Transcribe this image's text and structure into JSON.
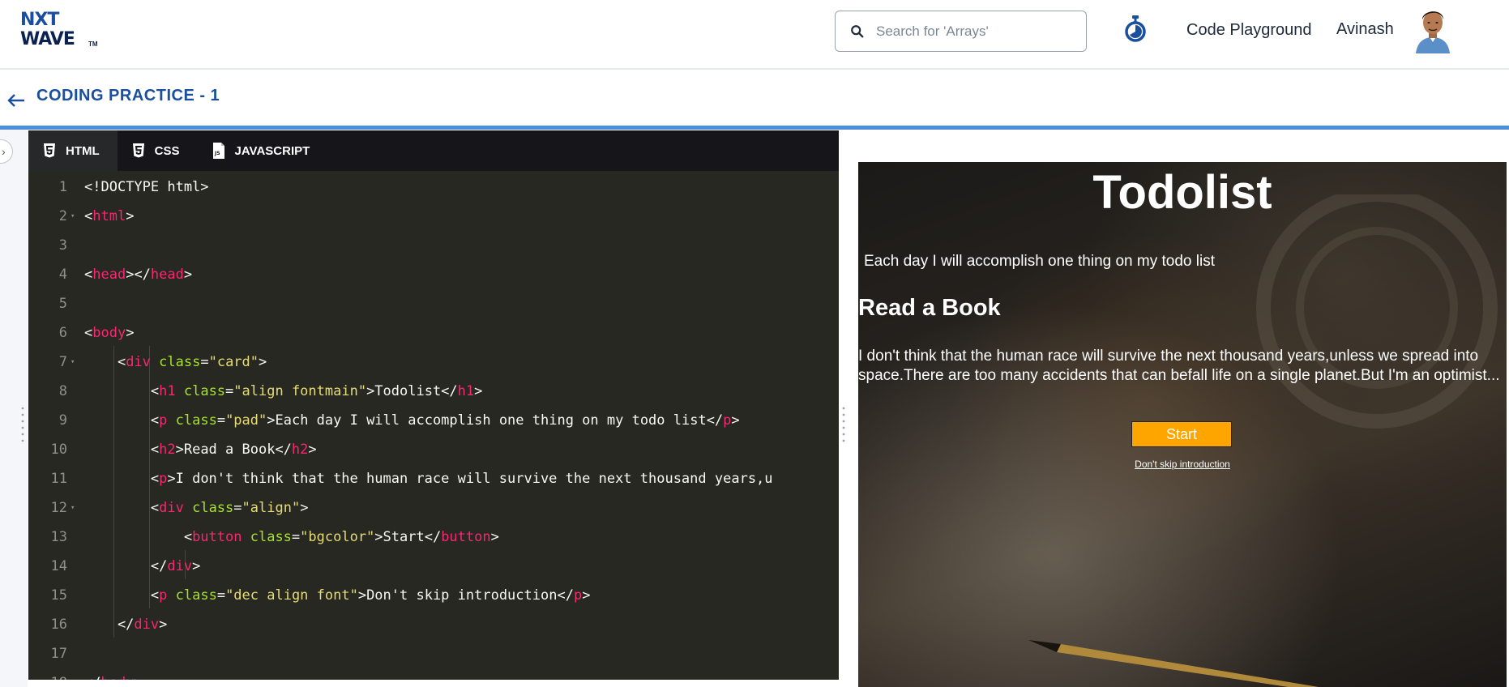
{
  "brand": {
    "logo_line1": "NXT",
    "logo_line2": "WAVE",
    "logo_tm": "TM"
  },
  "header": {
    "search_placeholder": "Search for 'Arrays'",
    "code_playground": "Code Playground",
    "username": "Avinash"
  },
  "page": {
    "title": "CODING PRACTICE - 1"
  },
  "editor": {
    "tabs": [
      {
        "label": "HTML",
        "icon": "html5-icon",
        "active": true
      },
      {
        "label": "CSS",
        "icon": "css3-icon",
        "active": false
      },
      {
        "label": "JAVASCRIPT",
        "icon": "js-file-icon",
        "active": false
      }
    ],
    "lines": [
      "<!DOCTYPE html>",
      "<html>",
      "",
      "<head></head>",
      "",
      "<body>",
      "    <div class=\"card\">",
      "        <h1 class=\"align fontmain\">Todolist</h1>",
      "        <p class=\"pad\">Each day I will accomplish one thing on my todo list</p>",
      "        <h2>Read a Book</h2>",
      "        <p>I don't think that the human race will survive the next thousand years,u",
      "        <div class=\"align\">",
      "            <button class=\"bgcolor\">Start</button>",
      "        </div>",
      "        <p class=\"dec align font\">Don't skip introduction</p>",
      "    </div>",
      "",
      "</body>"
    ]
  },
  "preview": {
    "title": "Todolist",
    "pad_text": "Each day I will accomplish one thing on my todo list",
    "heading": "Read a Book",
    "paragraph": "I don't think that the human race will survive the next thousand years,unless we spread into space.There are too many accidents that can befall life on a single planet.But I'm an optimist...",
    "button": "Start",
    "skip": "Don't skip introduction"
  },
  "colors": {
    "brand_blue": "#1a4fa0",
    "editor_bg": "#272822",
    "tag": "#f92672",
    "attr": "#a6e22e",
    "string": "#e6db74",
    "start_button": "#ffa500"
  }
}
